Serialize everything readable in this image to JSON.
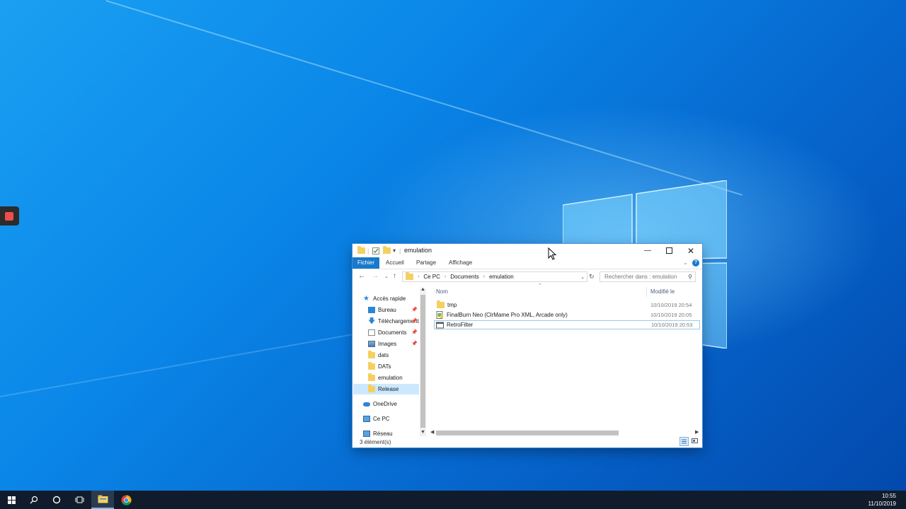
{
  "window": {
    "title": "emulation",
    "ribbon_tabs": [
      "Fichier",
      "Accueil",
      "Partage",
      "Affichage"
    ],
    "breadcrumb": [
      "Ce PC",
      "Documents",
      "emulation"
    ],
    "search_placeholder": "Rechercher dans : emulation",
    "columns": {
      "name": "Nom",
      "modified": "Modifié le"
    },
    "files": [
      {
        "name": "tmp",
        "modified": "10/10/2019 20:54",
        "icon": "folder-icon"
      },
      {
        "name": "FinalBurn Neo (ClrMame Pro XML, Arcade only)",
        "modified": "10/10/2019 20:05",
        "icon": "dat-file-icon"
      },
      {
        "name": "RetroFilter",
        "modified": "10/10/2019 20:53",
        "icon": "app-icon"
      }
    ],
    "status": "3 élément(s)"
  },
  "navpane": {
    "quick_access": "Accès rapide",
    "items": [
      {
        "label": "Bureau",
        "icon": "desktop-icon",
        "pinned": true
      },
      {
        "label": "Téléchargements",
        "icon": "download-icon",
        "pinned": true
      },
      {
        "label": "Documents",
        "icon": "documents-icon",
        "pinned": true
      },
      {
        "label": "Images",
        "icon": "images-icon",
        "pinned": true
      },
      {
        "label": "dats",
        "icon": "folder-icon",
        "pinned": false
      },
      {
        "label": "DATs",
        "icon": "folder-icon",
        "pinned": false
      },
      {
        "label": "emulation",
        "icon": "folder-icon",
        "pinned": false
      },
      {
        "label": "Release",
        "icon": "folder-icon",
        "pinned": false,
        "selected": true
      }
    ],
    "onedrive": "OneDrive",
    "this_pc": "Ce PC",
    "network": "Réseau"
  },
  "taskbar": {
    "time": "10:55",
    "date": "11/10/2019"
  },
  "colors": {
    "accent": "#1979ca",
    "selection": "#cce8ff",
    "taskbar": "#101c2b"
  }
}
